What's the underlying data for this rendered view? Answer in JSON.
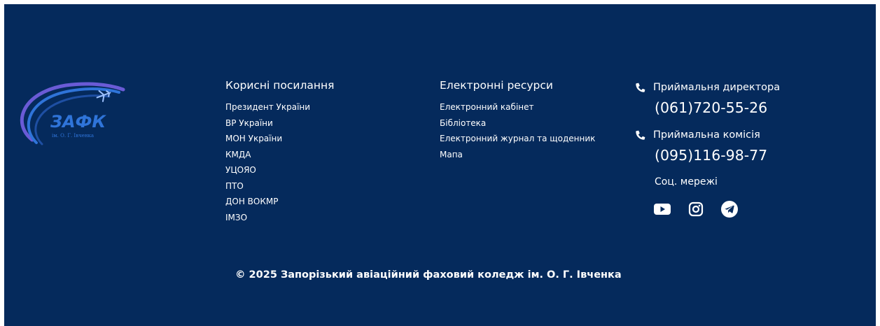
{
  "colors": {
    "background": "#052a5c",
    "text": "#ffffff",
    "logo_accent": "#2f74d9",
    "logo_secondary": "#6a5bd6"
  },
  "logo": {
    "text": "ЗАФК",
    "subtitle": "ім. О. Г. Івченка",
    "icon": "airplane-logo-icon"
  },
  "useful_links": {
    "title": "Корисні посилання",
    "items": [
      "Президент України",
      "ВР України",
      "МОН України",
      "КМДА",
      "УЦОЯО",
      "ПТО",
      "ДОН ВОКМР",
      "ІМЗО"
    ]
  },
  "e_resources": {
    "title": "Електронні ресурси",
    "items": [
      "Електронний кабінет",
      "Бібліотека",
      "Електронний журнал та щоденник",
      "Мапа"
    ]
  },
  "contacts": {
    "director": {
      "label": "Приймальня директора",
      "phone": "(061)720-55-26",
      "icon": "phone-icon"
    },
    "admissions": {
      "label": "Приймальна комісія",
      "phone": "(095)116-98-77",
      "icon": "phone-icon"
    }
  },
  "social": {
    "title": "Соц. мережі",
    "networks": [
      "youtube-icon",
      "instagram-icon",
      "telegram-icon"
    ]
  },
  "copyright": "© 2025 Запорізький авіаційний фаховий коледж ім. О. Г. Івченка"
}
